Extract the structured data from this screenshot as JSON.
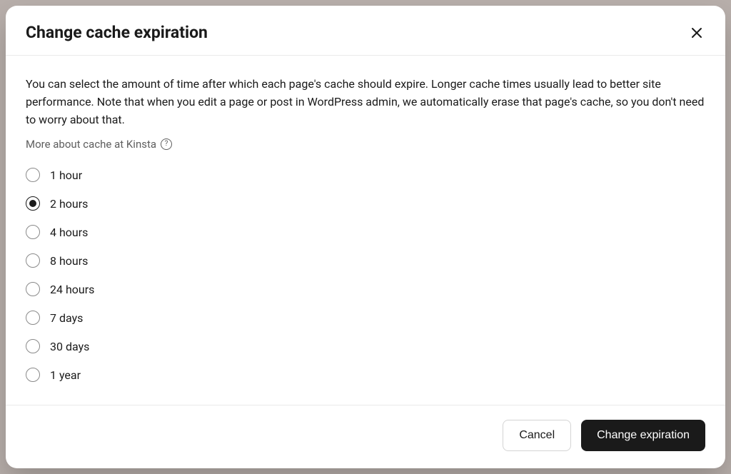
{
  "modal": {
    "title": "Change cache expiration",
    "description": "You can select the amount of time after which each page's cache should expire. Longer cache times usually lead to better site performance. Note that when you edit a page or post in WordPress admin, we automatically erase that page's cache, so you don't need to worry about that.",
    "help_link": "More about cache at Kinsta",
    "options": [
      {
        "label": "1 hour",
        "selected": false
      },
      {
        "label": "2 hours",
        "selected": true
      },
      {
        "label": "4 hours",
        "selected": false
      },
      {
        "label": "8 hours",
        "selected": false
      },
      {
        "label": "24 hours",
        "selected": false
      },
      {
        "label": "7 days",
        "selected": false
      },
      {
        "label": "30 days",
        "selected": false
      },
      {
        "label": "1 year",
        "selected": false
      }
    ],
    "cancel_label": "Cancel",
    "submit_label": "Change expiration"
  }
}
